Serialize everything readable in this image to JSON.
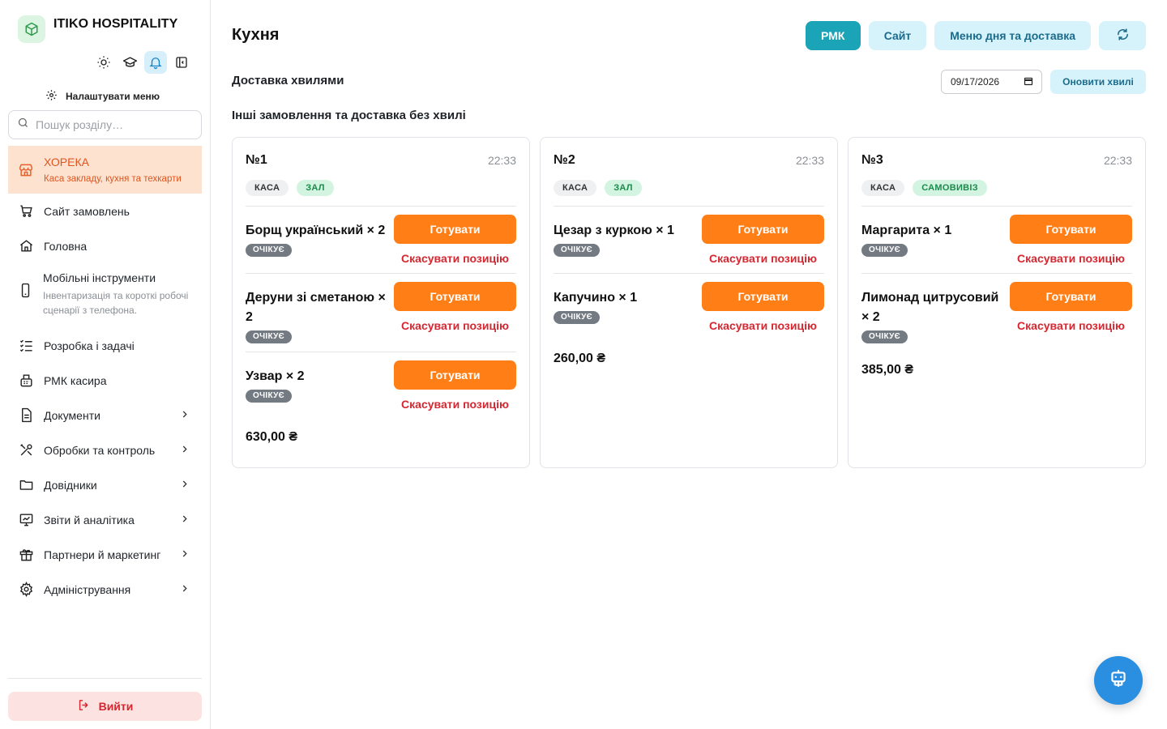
{
  "sidebar": {
    "brand": "ITIKO HOSPITALITY",
    "config_menu": "Налаштувати меню",
    "search_placeholder": "Пошук розділу…",
    "items": [
      {
        "title": "ХОРЕКА",
        "sub": "Каса закладу, кухня та техкарти",
        "icon": "store-icon"
      },
      {
        "title": "Сайт замовлень",
        "icon": "cart-icon"
      },
      {
        "title": "Головна",
        "icon": "home-icon"
      },
      {
        "title": "Мобільні інструменти",
        "sub": "Інвентаризація та короткі робочі сценарії з телефона.",
        "icon": "phone-icon"
      },
      {
        "title": "Розробка і задачі",
        "icon": "checklist-icon"
      },
      {
        "title": "РМК касира",
        "icon": "cash-register-icon"
      },
      {
        "title": "Документи",
        "icon": "document-icon"
      },
      {
        "title": "Обробки та контроль",
        "icon": "tools-icon"
      },
      {
        "title": "Довідники",
        "icon": "folder-icon"
      },
      {
        "title": "Звіти й аналітика",
        "icon": "chart-icon"
      },
      {
        "title": "Партнери й маркетинг",
        "icon": "gift-icon"
      },
      {
        "title": "Адміністрування",
        "icon": "gear-icon"
      }
    ],
    "logout": "Вийти"
  },
  "header": {
    "title": "Кухня",
    "actions": {
      "rmk": "РМК",
      "site": "Сайт",
      "menu_day": "Меню дня та доставка"
    }
  },
  "waves": {
    "title": "Доставка хвилями",
    "date": "09/17/2026",
    "refresh": "Оновити хвилі"
  },
  "other_orders_title": "Інші замовлення та доставка без хвилі",
  "labels": {
    "cook": "Готувати",
    "cancel": "Скасувати позицію",
    "waiting": "ОЧІКУЄ"
  },
  "orders": [
    {
      "number": "№1",
      "time": "22:33",
      "tags": [
        "КАСА",
        "ЗАЛ"
      ],
      "items": [
        {
          "name": "Борщ український × 2"
        },
        {
          "name": "Деруни зі сметаною × 2"
        },
        {
          "name": "Узвар × 2"
        }
      ],
      "total": "630,00 ₴"
    },
    {
      "number": "№2",
      "time": "22:33",
      "tags": [
        "КАСА",
        "ЗАЛ"
      ],
      "items": [
        {
          "name": "Цезар з куркою × 1"
        },
        {
          "name": "Капучино × 1"
        }
      ],
      "total": "260,00 ₴"
    },
    {
      "number": "№3",
      "time": "22:33",
      "tags": [
        "КАСА",
        "САМОВИВІЗ"
      ],
      "items": [
        {
          "name": "Маргарита × 1"
        },
        {
          "name": "Лимонад цитрусовий × 2"
        }
      ],
      "total": "385,00 ₴"
    }
  ],
  "colors": {
    "accent": "#1ba3b8",
    "cook": "#ff7f16",
    "danger": "#d7262f",
    "active_nav_bg": "#fde3cf"
  }
}
